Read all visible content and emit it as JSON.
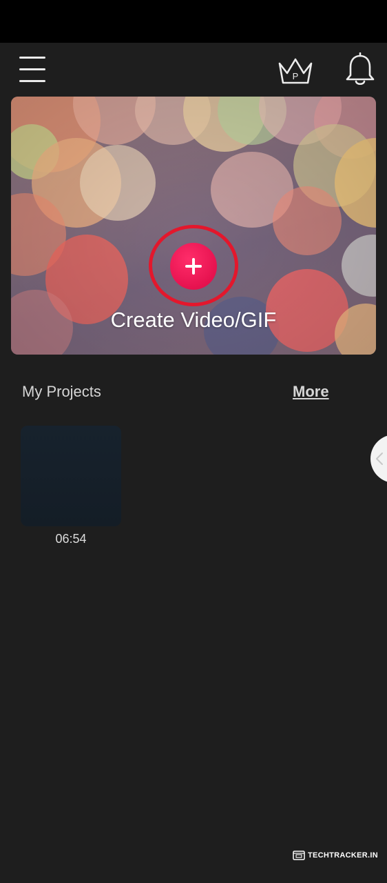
{
  "header": {
    "menu_icon": "hamburger-menu-icon",
    "premium_icon": "crown-icon",
    "premium_letter": "P",
    "notifications_icon": "bell-icon"
  },
  "hero": {
    "create_label": "Create Video/GIF",
    "create_icon": "plus-icon",
    "highlight_color": "#e3172c",
    "button_color": "#e6124f"
  },
  "projects": {
    "title": "My Projects",
    "more_label": "More",
    "items": [
      {
        "duration": "06:54"
      }
    ]
  },
  "side_tab": {
    "icon": "chevron-left-icon"
  },
  "watermark": {
    "text": "TECHTRACKER.IN",
    "icon": "watermark-logo-icon"
  },
  "colors": {
    "background": "#1e1e1e",
    "status_bar": "#000000",
    "text_primary": "#d6d6d6"
  }
}
